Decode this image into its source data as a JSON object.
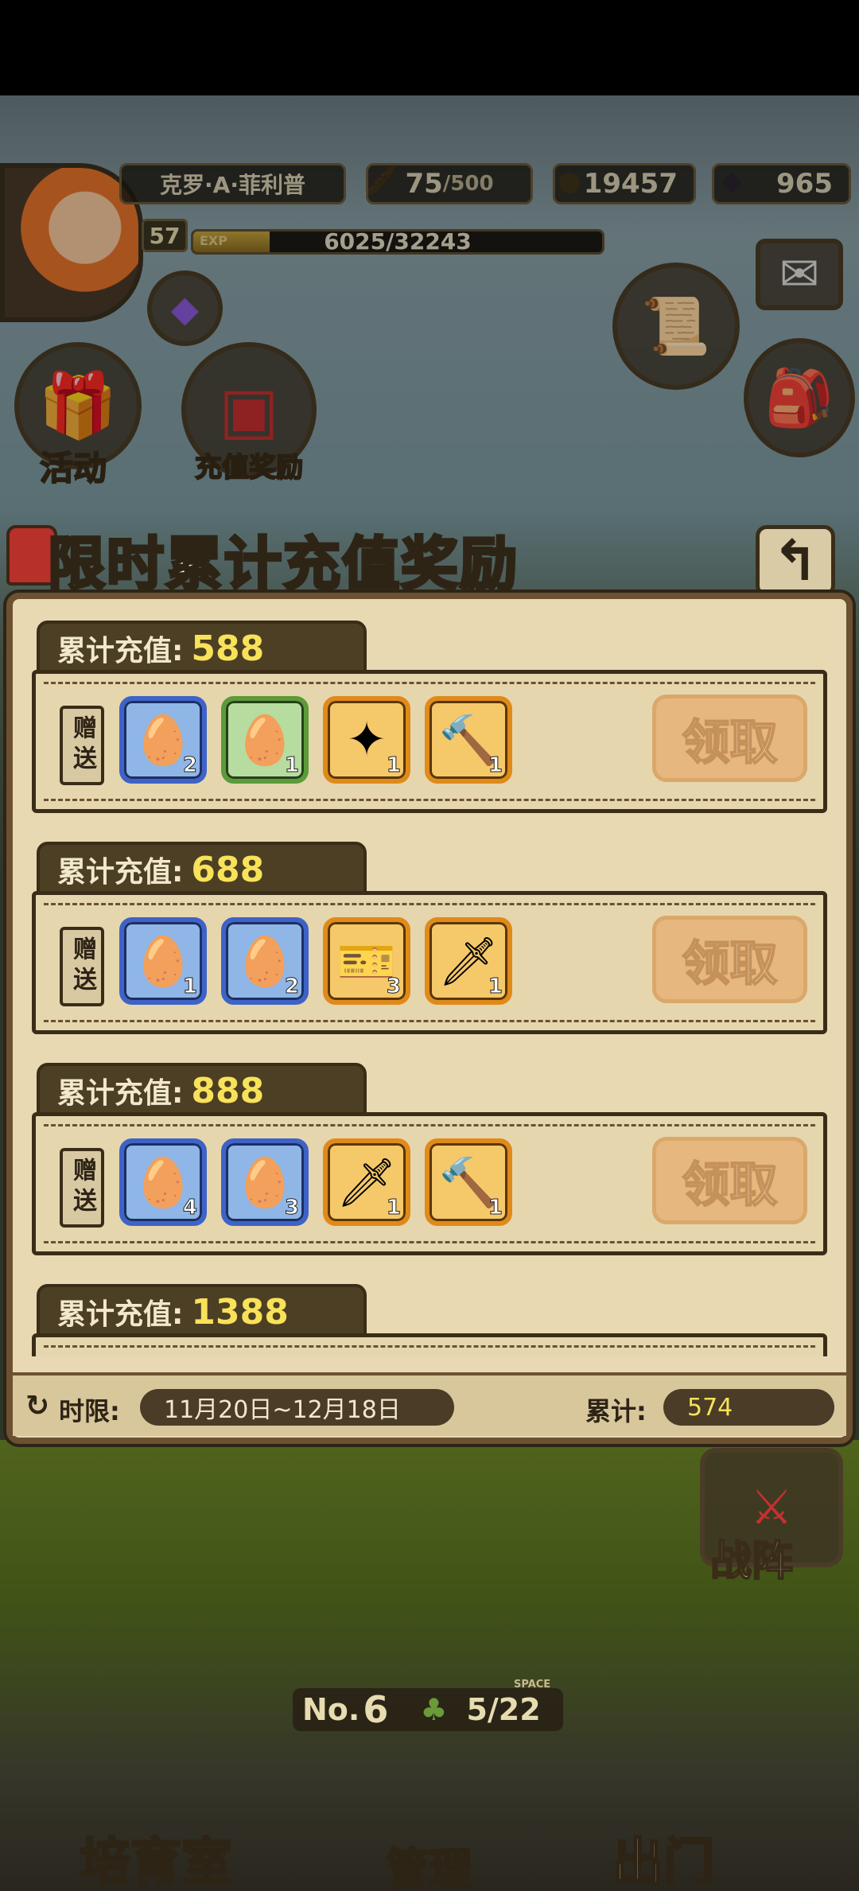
{
  "header": {
    "player_name": "克罗·A·菲利普",
    "level": "57",
    "exp_label": "EXP",
    "exp_text": "6025/32243",
    "exp_current": 6025,
    "exp_max": 32243,
    "stamina_value": "75",
    "stamina_max": "/500",
    "gold": "19457",
    "gems": "965"
  },
  "side_buttons": {
    "activity": "活动",
    "recharge_reward": "充值奖励",
    "formation": "战阵"
  },
  "dialog": {
    "title": "限时累计充值奖励",
    "gift_label": "赠送",
    "claim_label": "领取",
    "tier_prefix": "累计充值:",
    "tiers": [
      {
        "amount": "588",
        "items": [
          {
            "icon": "fruit-egg",
            "frame": "blue",
            "count": "2"
          },
          {
            "icon": "white-egg",
            "frame": "green",
            "count": "1"
          },
          {
            "icon": "golden-wings",
            "frame": "orange",
            "count": "1"
          },
          {
            "icon": "hammer",
            "frame": "orange",
            "count": "1"
          }
        ]
      },
      {
        "amount": "688",
        "items": [
          {
            "icon": "rainbow-egg",
            "frame": "blue",
            "count": "1"
          },
          {
            "icon": "fruit-egg",
            "frame": "blue",
            "count": "2"
          },
          {
            "icon": "ticket",
            "frame": "orange",
            "count": "3"
          },
          {
            "icon": "sword",
            "frame": "orange",
            "count": "1"
          }
        ]
      },
      {
        "amount": "888",
        "items": [
          {
            "icon": "fruit-egg",
            "frame": "blue",
            "count": "4"
          },
          {
            "icon": "rainbow-egg",
            "frame": "blue",
            "count": "3"
          },
          {
            "icon": "sword",
            "frame": "orange",
            "count": "1"
          },
          {
            "icon": "hammer",
            "frame": "orange",
            "count": "1"
          }
        ]
      },
      {
        "amount": "1388",
        "items": []
      }
    ],
    "footer": {
      "time_label": "时限:",
      "time_range": "11月20日~12月18日",
      "total_label": "累计:",
      "total_value": "574"
    }
  },
  "bottom": {
    "nest_no": "No.",
    "nest_num": "6",
    "space_label": "SPACE",
    "space_value": "5/22",
    "nav": [
      "培育室",
      "管理",
      "出门"
    ]
  },
  "colors": {
    "accent_yellow": "#f7e25a",
    "panel": "#e8d9b3",
    "frame_blue": "#3e63c8",
    "frame_green": "#5c9a3a",
    "frame_orange": "#e08a1a"
  }
}
